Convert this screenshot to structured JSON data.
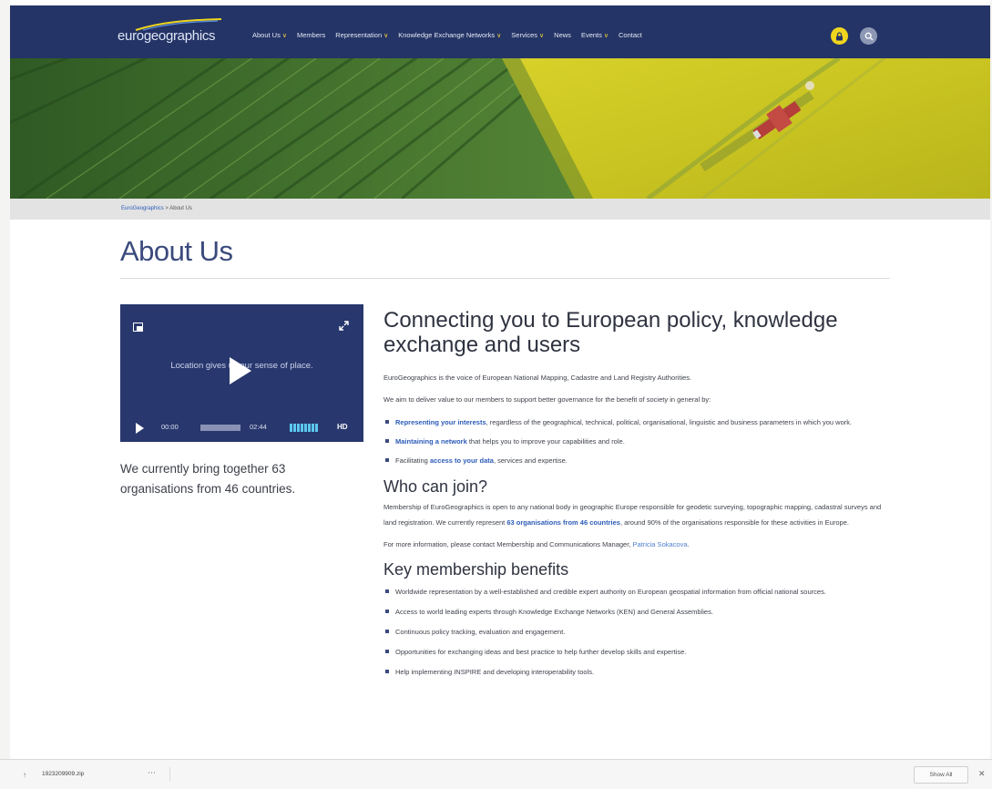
{
  "header": {
    "logo_text": "eurogeographics",
    "nav": [
      {
        "label": "About Us",
        "dropdown": true
      },
      {
        "label": "Members",
        "dropdown": false
      },
      {
        "label": "Representation",
        "dropdown": true
      },
      {
        "label": "Knowledge Exchange Networks",
        "dropdown": true
      },
      {
        "label": "Services",
        "dropdown": true
      },
      {
        "label": "News",
        "dropdown": false
      },
      {
        "label": "Events",
        "dropdown": true
      },
      {
        "label": "Contact",
        "dropdown": false
      }
    ],
    "colors": {
      "bar": "#243466",
      "accent": "#f0d51e"
    }
  },
  "breadcrumb": {
    "home": "EuroGeographics",
    "separator": ">",
    "current": "About Us"
  },
  "page_title": "About Us",
  "video": {
    "overlay_text": "Location gives us our sense of place.",
    "current_time": "00:00",
    "duration": "02:44",
    "progress": 0.0,
    "quality": "HD"
  },
  "side_text": "We currently bring together 63 organisations from 46 countries.",
  "content": {
    "heading": "Connecting you to European policy, knowledge exchange and users",
    "intro1": "EuroGeographics is the voice of European National Mapping, Cadastre and Land Registry Authorities.",
    "intro2": "We aim to deliver value to our members to support better governance for the benefit of society in general by:",
    "aims": [
      {
        "link": "Representing your interests",
        "text": ", regardless of the geographical, technical, political, organisational, linguistic and business parameters in which you work."
      },
      {
        "link": "Maintaining a network",
        "text": " that helps you to improve your capabilities and role."
      },
      {
        "prefix": "Facilitating ",
        "link": "access to your data",
        "text": ", services and expertise."
      }
    ],
    "join_heading": "Who can join?",
    "join_text": "Membership of EuroGeographics is open to any national body in geographic Europe responsible for geodetic surveying, topographic mapping, cadastral surveys and land registration. We currently represent ",
    "join_link": "63 organisations from 46 countries",
    "join_text_end": ", around 90% of the organisations responsible for these activities in Europe.",
    "contact_text": "For more information, please contact Membership and Communications Manager, ",
    "contact_link": "Patricia Sokacova",
    "contact_end": ".",
    "benefits_heading": "Key membership benefits",
    "benefits": [
      "Worldwide representation by a well-established and credible expert authority on European geospatial information from official national sources.",
      "Access to world leading experts through Knowledge Exchange Networks (KEN) and General Assemblies.",
      "Continuous policy tracking, evaluation and engagement.",
      "Opportunities for exchanging ideas and best practice to help further develop skills and expertise.",
      "Help implementing INSPIRE and developing interoperability tools."
    ]
  },
  "download_bar": {
    "filename": "1923209909.zip",
    "show_all": "Show All"
  }
}
